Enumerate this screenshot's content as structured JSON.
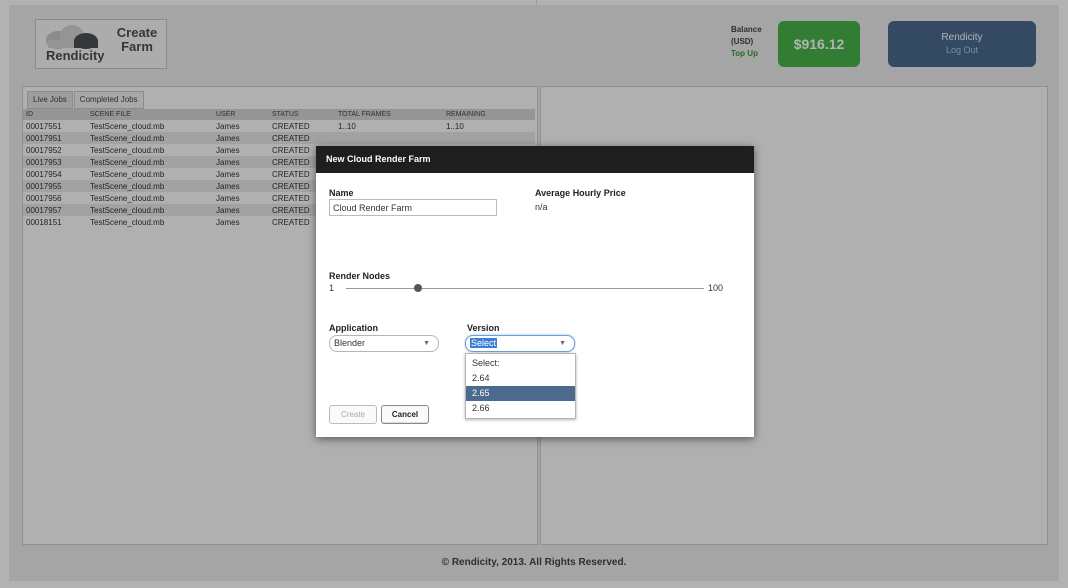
{
  "header": {
    "brand": "Rendicity",
    "create_line1": "Create",
    "create_line2": "Farm",
    "balance_label_1": "Balance",
    "balance_label_2": "(USD)",
    "topup_link": "Top Up",
    "balance_amount": "$916.12",
    "user_name": "Rendicity",
    "logout_link": "Log Out"
  },
  "tabs": [
    {
      "label": "Live Jobs",
      "active": true
    },
    {
      "label": "Completed Jobs",
      "active": false
    }
  ],
  "jobs": {
    "columns": [
      "ID",
      "SCENE FILE",
      "USER",
      "STATUS",
      "TOTAL FRAMES",
      "REMAINING"
    ],
    "rows": [
      [
        "00017551",
        "TestScene_cloud.mb",
        "James",
        "CREATED",
        "1..10",
        "1..10"
      ],
      [
        "00017951",
        "TestScene_cloud.mb",
        "James",
        "CREATED",
        "",
        ""
      ],
      [
        "00017952",
        "TestScene_cloud.mb",
        "James",
        "CREATED",
        "",
        ""
      ],
      [
        "00017953",
        "TestScene_cloud.mb",
        "James",
        "CREATED",
        "",
        ""
      ],
      [
        "00017954",
        "TestScene_cloud.mb",
        "James",
        "CREATED",
        "",
        ""
      ],
      [
        "00017955",
        "TestScene_cloud.mb",
        "James",
        "CREATED",
        "",
        ""
      ],
      [
        "00017956",
        "TestScene_cloud.mb",
        "James",
        "CREATED",
        "",
        ""
      ],
      [
        "00017957",
        "TestScene_cloud.mb",
        "James",
        "CREATED",
        "",
        ""
      ],
      [
        "00018151",
        "TestScene_cloud.mb",
        "James",
        "CREATED",
        "",
        ""
      ]
    ]
  },
  "modal": {
    "title": "New Cloud Render Farm",
    "name_label": "Name",
    "name_value": "Cloud Render Farm",
    "price_label": "Average Hourly Price",
    "price_value": "n/a",
    "nodes_label": "Render Nodes",
    "nodes_min": "1",
    "nodes_max": "100",
    "nodes_value_fraction": 0.2,
    "application_label": "Application",
    "application_value": "Blender",
    "version_label": "Version",
    "version_value": "Select",
    "version_options": [
      "Select:",
      "2.64",
      "2.65",
      "2.66"
    ],
    "version_highlighted": "2.65",
    "create_button": "Create",
    "cancel_button": "Cancel"
  },
  "footer": "© Rendicity, 2013. All Rights Reserved.",
  "colors": {
    "balance_green": "#49b249",
    "user_box_blue": "#4b6a8e",
    "modal_header": "#1e1e1e",
    "dropdown_highlight": "#4b6a8e"
  }
}
